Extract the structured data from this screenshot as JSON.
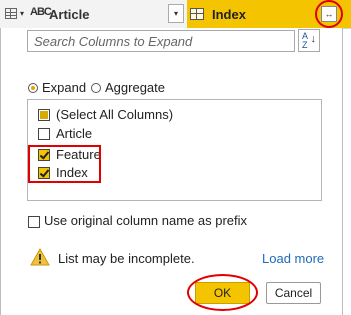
{
  "header": {
    "type_icon_text": "ABC",
    "article_column": "Article",
    "index_column": "Index",
    "sort_glyph": "▾",
    "expand_button_glyph": "↔"
  },
  "search": {
    "placeholder": "Search Columns to Expand"
  },
  "sort_button": {
    "top_letter": "A",
    "bottom_letter": "Z",
    "arrow": "↓"
  },
  "mode": {
    "expand_label": "Expand",
    "aggregate_label": "Aggregate",
    "selected": "Expand"
  },
  "columns": [
    {
      "label": "(Select All Columns)",
      "state": "partial"
    },
    {
      "label": "Article",
      "state": "unchecked"
    },
    {
      "label": "Feature",
      "state": "checked"
    },
    {
      "label": "Index",
      "state": "checked"
    }
  ],
  "prefix_option": {
    "label": "Use original column name as prefix",
    "checked": false
  },
  "warning": {
    "icon": "warning-triangle-icon",
    "text": "List may be incomplete.",
    "link": "Load more"
  },
  "buttons": {
    "ok": "OK",
    "cancel": "Cancel"
  },
  "colors": {
    "accent": "#f5c400",
    "highlight": "#e00000",
    "link": "#1f6bb5"
  }
}
